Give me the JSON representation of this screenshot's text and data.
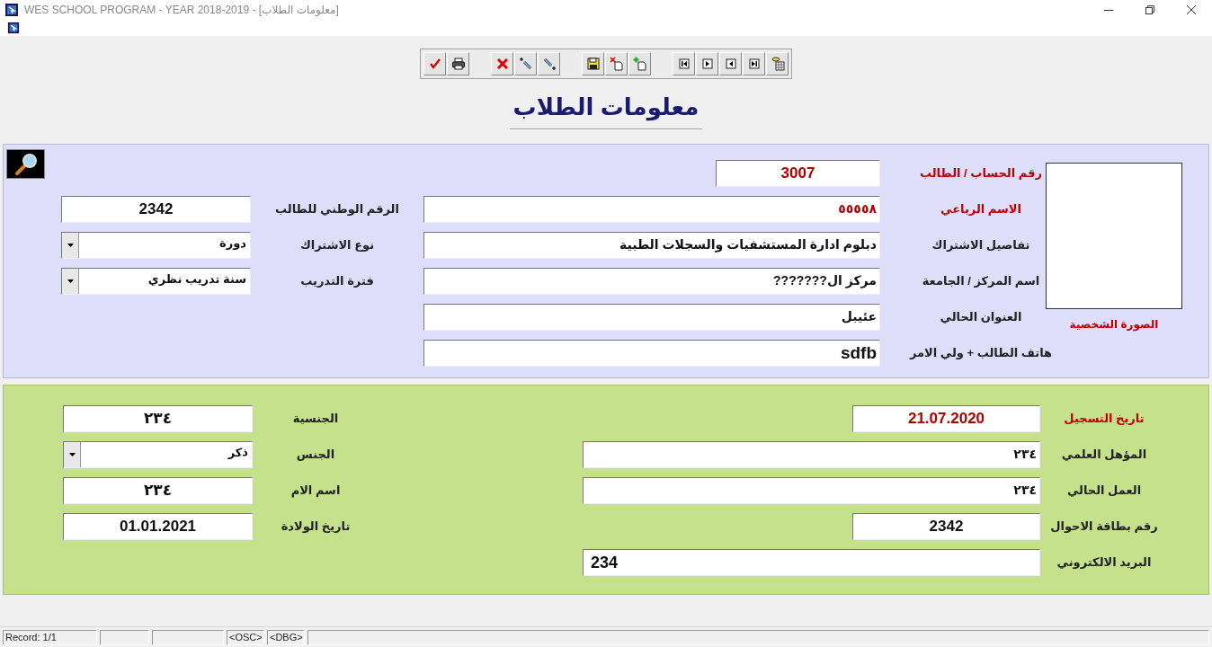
{
  "window": {
    "title": "WES SCHOOL PROGRAM - YEAR 2018-2019 - [معلومات الطلاب]"
  },
  "heading": "معلومات الطلاب",
  "student_panel": {
    "photo_caption": "الصورة الشخصية",
    "left_rows": [
      {
        "label": "الرقم الوطني للطالب",
        "value": "2342",
        "kind": "centered",
        "required": false
      },
      {
        "label": "نوع الاشتراك",
        "value": "دورة",
        "kind": "combo",
        "required": false
      },
      {
        "label": "فترة التدريب",
        "value": "سنة تدريب نظري",
        "kind": "combo",
        "required": false
      }
    ],
    "right_rows": [
      {
        "label": "رقم الحساب / الطالب",
        "value": "3007",
        "kind": "short",
        "required": true
      },
      {
        "label": "الاسم الرباعي",
        "value": "٥٥٥٥٨",
        "kind": "text",
        "required": true
      },
      {
        "label": "تفاصيل الاشتراك",
        "value": "دبلوم ادارة المستشفيات والسجلات الطبية",
        "kind": "text",
        "required": false
      },
      {
        "label": "اسم المركز / الجامعة",
        "value": "مركز ال???????",
        "kind": "text",
        "required": false
      },
      {
        "label": "العنوان الحالي",
        "value": "عئيبل",
        "kind": "text",
        "required": false
      },
      {
        "label": "هاتف الطالب + ولي الامر",
        "value": "sdfb",
        "kind": "text",
        "required": false
      }
    ]
  },
  "details_panel": {
    "left_rows": [
      {
        "label": "الجنسية",
        "value": "٢٣٤",
        "kind": "centered",
        "required": false
      },
      {
        "label": "الجنس",
        "value": "ذكر",
        "kind": "combo",
        "required": false
      },
      {
        "label": "اسم الام",
        "value": "٢٣٤",
        "kind": "centered",
        "required": false
      },
      {
        "label": "تاريخ الولادة",
        "value": "01.01.2021",
        "kind": "centered",
        "required": false
      }
    ],
    "right_rows": [
      {
        "label": "تاريخ التسجيل",
        "value": "21.07.2020",
        "kind": "short",
        "required": true
      },
      {
        "label": "المؤهل العلمي",
        "value": "٢٣٤",
        "kind": "text",
        "required": false
      },
      {
        "label": "العمل الحالي",
        "value": "٢٣٤",
        "kind": "text",
        "required": false
      },
      {
        "label": "رقم بطاقة الاحوال",
        "value": "2342",
        "kind": "short",
        "required": false
      },
      {
        "label": "البريد الالكتروني",
        "value": "234",
        "kind": "latin",
        "required": false
      }
    ]
  },
  "status_bar": {
    "record": "Record: 1/1",
    "osc": "<OSC>",
    "dbg": "<DBG>"
  }
}
